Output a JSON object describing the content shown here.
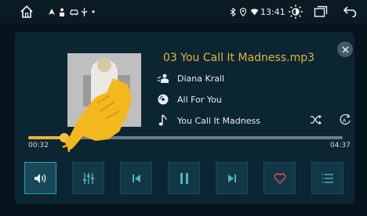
{
  "status_bar": {
    "time": "13:41",
    "icons": [
      "home-icon",
      "navigation-icon",
      "person-icon",
      "car-icon",
      "usb-icon",
      "dot-icon",
      "bluetooth-icon",
      "location-icon",
      "wifi-icon",
      "brightness-icon",
      "window-icon",
      "back-icon"
    ]
  },
  "player": {
    "album_art": "Diana Krall album cover",
    "track_title": "03 You Call It Madness.mp3",
    "artist": "Diana Krall",
    "album": "All For You",
    "song": "You Call It Madness",
    "elapsed": "00:32",
    "duration": "04:37",
    "progress": 0.115,
    "accent_color": "#e7b23c",
    "favorite_color": "#e34a5a"
  },
  "controls": {
    "buttons": [
      "volume",
      "equalizer",
      "previous",
      "pause",
      "next",
      "favorite",
      "playlist"
    ],
    "active": "volume"
  }
}
